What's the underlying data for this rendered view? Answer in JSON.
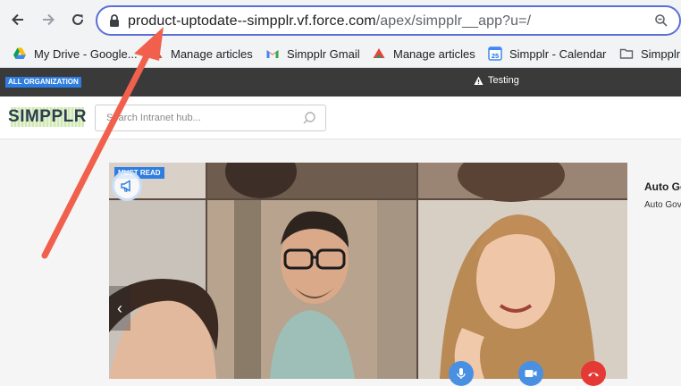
{
  "browser": {
    "url_host": "product-uptodate--simpplr.vf.force.com",
    "url_path": "/apex/simpplr__app?u=/",
    "icons": [
      "back-icon",
      "forward-icon",
      "reload-icon",
      "lock-icon",
      "zoom-icon"
    ]
  },
  "bookmarks": [
    {
      "label": "My Drive - Google...",
      "icon": "google-drive-icon"
    },
    {
      "label": "Manage articles",
      "icon": "triangle-icon"
    },
    {
      "label": "Simpplr Gmail",
      "icon": "gmail-icon"
    },
    {
      "label": "Manage articles",
      "icon": "triangle-icon"
    },
    {
      "label": "Simpplr - Calendar",
      "icon": "calendar-icon",
      "calendar_day": "25"
    },
    {
      "label": "Simpplr",
      "icon": "folder-icon"
    }
  ],
  "topbar": {
    "org_badge": "ALL ORGANIZATION",
    "env_label": "Testing"
  },
  "header": {
    "logo_text": "SIMPPLR",
    "search_placeholder": "Search Intranet hub..."
  },
  "carousel": {
    "badge": "MUST READ",
    "prev_label": "‹"
  },
  "side_panel": {
    "title": "Auto Go",
    "subtitle": "Auto Gov"
  },
  "colors": {
    "accent": "#2e7de0",
    "omnibox_border": "#5b6fd6",
    "annotation_arrow": "#f0604d",
    "topbar": "#3a3a3a"
  }
}
